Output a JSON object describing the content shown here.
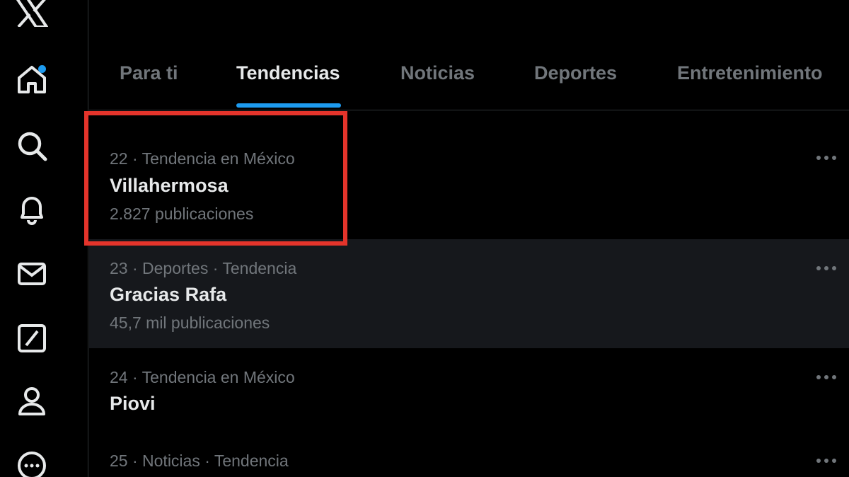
{
  "sidebar": {
    "items": [
      {
        "icon": "x-logo-icon"
      },
      {
        "icon": "home-icon",
        "notification": true
      },
      {
        "icon": "search-icon"
      },
      {
        "icon": "bell-icon"
      },
      {
        "icon": "mail-icon"
      },
      {
        "icon": "grok-icon"
      },
      {
        "icon": "profile-icon"
      },
      {
        "icon": "more-circle-icon"
      }
    ]
  },
  "tabs": [
    {
      "label": "Para ti",
      "active": false
    },
    {
      "label": "Tendencias",
      "active": true
    },
    {
      "label": "Noticias",
      "active": false
    },
    {
      "label": "Deportes",
      "active": false
    },
    {
      "label": "Entretenimiento",
      "active": false
    }
  ],
  "trends": [
    {
      "meta": "22 · Tendencia en México",
      "name": "Villahermosa",
      "count": "2.827 publicaciones"
    },
    {
      "meta": "23 · Deportes · Tendencia",
      "name": "Gracias Rafa",
      "count": "45,7 mil publicaciones"
    },
    {
      "meta": "24 · Tendencia en México",
      "name": "Piovi",
      "count": ""
    },
    {
      "meta": "25 · Noticias · Tendencia",
      "name": "",
      "count": ""
    }
  ],
  "colors": {
    "background": "#000000",
    "accent": "#1d9bf0",
    "highlight": "#e4342b",
    "muted_text": "#71767b",
    "primary_text": "#e7e9ea",
    "hover_row": "#16181c"
  }
}
